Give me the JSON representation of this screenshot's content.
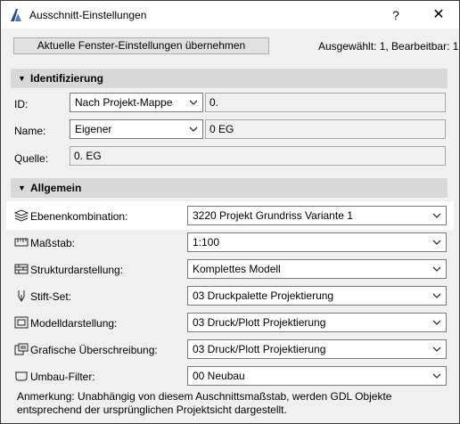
{
  "window": {
    "title": "Ausschnitt-Einstellungen",
    "help_label": "?",
    "close_label": "✕"
  },
  "top": {
    "apply_button": "Aktuelle Fenster-Einstellungen übernehmen",
    "selection_info": "Ausgewählt: 1, Bearbeitbar: 1"
  },
  "identification": {
    "header": "Identifizierung",
    "id_label": "ID:",
    "id_mode": "Nach Projekt-Mappe",
    "id_value": "0.",
    "name_label": "Name:",
    "name_mode": "Eigener",
    "name_value": "0 EG",
    "source_label": "Quelle:",
    "source_value": "0. EG"
  },
  "general": {
    "header": "Allgemein",
    "rows": [
      {
        "icon": "layers-icon",
        "label": "Ebenenkombination:",
        "value": "3220 Projekt Grundriss Variante 1"
      },
      {
        "icon": "scale-ruler-icon",
        "label": "Maßstab:",
        "value": "1:100"
      },
      {
        "icon": "structure-hatch-icon",
        "label": "Strukturdarstellung:",
        "value": "Komplettes Modell"
      },
      {
        "icon": "pen-nib-icon",
        "label": "Stift-Set:",
        "value": "03 Druckpalette Projektierung"
      },
      {
        "icon": "model-display-icon",
        "label": "Modelldarstellung:",
        "value": "03 Druck/Plott Projektierung"
      },
      {
        "icon": "graphic-override-icon",
        "label": "Grafische Überschreibung:",
        "value": "03 Druck/Plott Projektierung"
      },
      {
        "icon": "renovation-filter-icon",
        "label": "Umbau-Filter:",
        "value": "00 Neubau"
      }
    ]
  },
  "note": "Anmerkung: Unabhängig von diesem Auschnittsmaßstab, werden GDL Objekte entsprechend der ursprünglichen Projektsicht dargestellt."
}
